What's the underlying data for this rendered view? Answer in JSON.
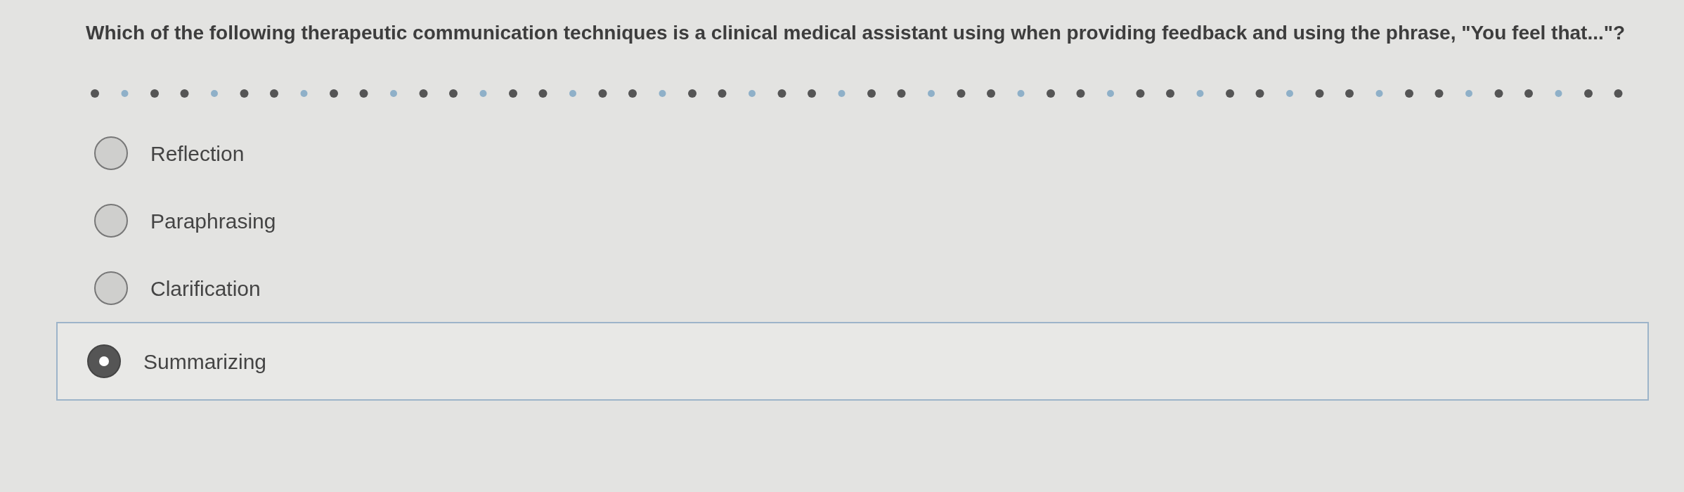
{
  "question": "Which of the following therapeutic communication techniques is a clinical medical assistant using when providing feedback and using the phrase, \"You feel that...\"?",
  "options": [
    {
      "label": "Reflection",
      "selected": false
    },
    {
      "label": "Paraphrasing",
      "selected": false
    },
    {
      "label": "Clarification",
      "selected": false
    },
    {
      "label": "Summarizing",
      "selected": true
    }
  ]
}
